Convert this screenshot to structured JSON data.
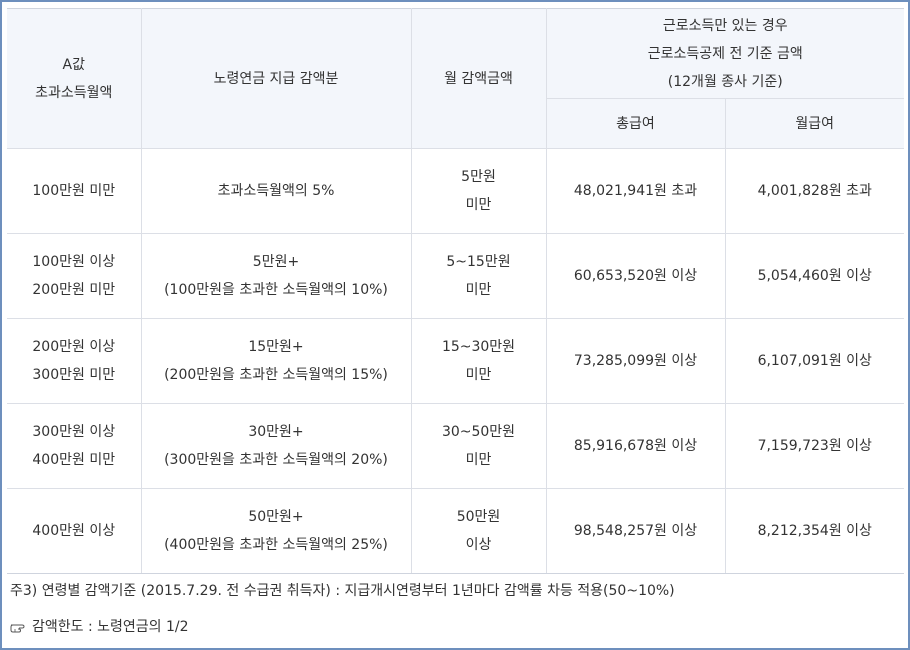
{
  "header": {
    "col1_line1": "A값",
    "col1_line2": "초과소득월액",
    "col2": "노령연금 지급 감액분",
    "col3": "월 감액금액",
    "col4_line1": "근로소득만 있는 경우",
    "col4_line2": "근로소득공제 전 기준 금액",
    "col4_line3": "(12개월 종사 기준)",
    "sub_total": "총급여",
    "sub_monthly": "월급여"
  },
  "rows": [
    {
      "income_l1": "100만원 미만",
      "income_l2": "",
      "reduction_l1": "초과소득월액의 5%",
      "reduction_l2": "",
      "monthly_l1": "5만원",
      "monthly_l2": "미만",
      "total_pay": "48,021,941원 초과",
      "monthly_pay": "4,001,828원 초과"
    },
    {
      "income_l1": "100만원 이상",
      "income_l2": "200만원 미만",
      "reduction_l1": "5만원+",
      "reduction_l2": "(100만원을 초과한 소득월액의 10%)",
      "monthly_l1": "5~15만원",
      "monthly_l2": "미만",
      "total_pay": "60,653,520원 이상",
      "monthly_pay": "5,054,460원 이상"
    },
    {
      "income_l1": "200만원 이상",
      "income_l2": "300만원 미만",
      "reduction_l1": "15만원+",
      "reduction_l2": "(200만원을 초과한 소득월액의 15%)",
      "monthly_l1": "15~30만원",
      "monthly_l2": "미만",
      "total_pay": "73,285,099원 이상",
      "monthly_pay": "6,107,091원 이상"
    },
    {
      "income_l1": "300만원 이상",
      "income_l2": "400만원 미만",
      "reduction_l1": "30만원+",
      "reduction_l2": "(300만원을 초과한 소득월액의 20%)",
      "monthly_l1": "30~50만원",
      "monthly_l2": "미만",
      "total_pay": "85,916,678원 이상",
      "monthly_pay": "7,159,723원 이상"
    },
    {
      "income_l1": "400만원 이상",
      "income_l2": "",
      "reduction_l1": "50만원+",
      "reduction_l2": "(400만원을 초과한 소득월액의 25%)",
      "monthly_l1": "50만원",
      "monthly_l2": "이상",
      "total_pay": "98,548,257원 이상",
      "monthly_pay": "8,212,354원 이상"
    }
  ],
  "notes": {
    "note1": "주3) 연령별 감액기준 (2015.7.29. 전 수급권 취득자) : 지급개시연령부터 1년마다 감액률 차등 적용(50~10%)",
    "note2": "감액한도 : 노령연금의 1/2",
    "note2_icon": "pointing-hand-icon"
  },
  "colors": {
    "frame_border": "#6d8fbd",
    "header_bg": "#f3f6fb",
    "grid_line": "#dcdfe6",
    "text": "#333333"
  }
}
